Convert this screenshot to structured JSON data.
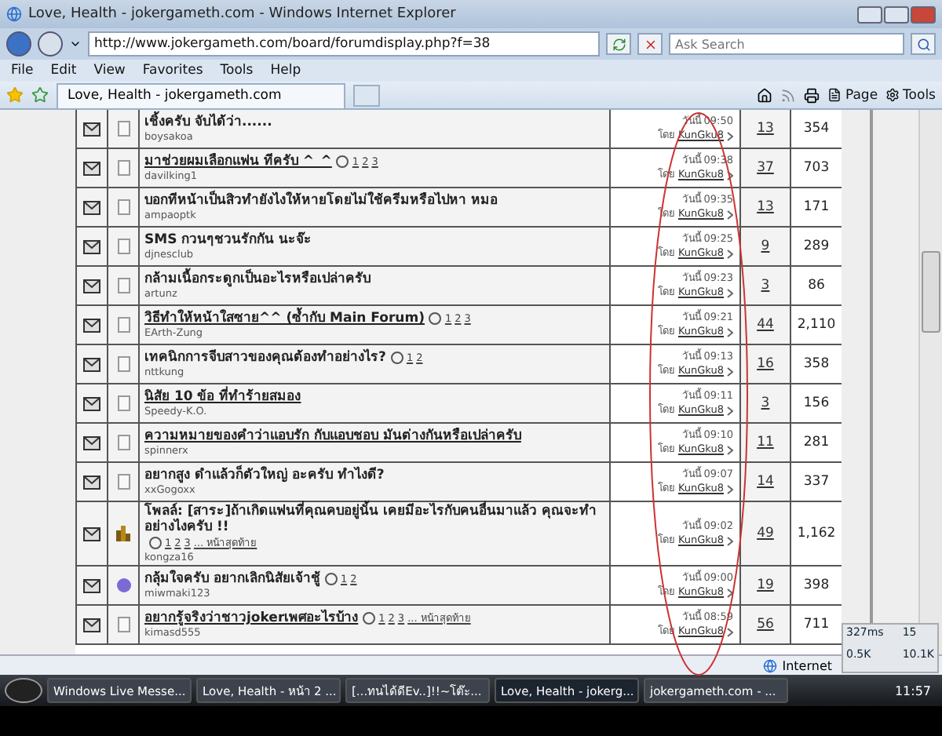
{
  "window": {
    "title": "Love, Health - jokergameth.com - Windows Internet Explorer"
  },
  "address_bar": {
    "url": "http://www.jokergameth.com/board/forumdisplay.php?f=38"
  },
  "search": {
    "placeholder": "Ask Search"
  },
  "menu": [
    "File",
    "Edit",
    "View",
    "Favorites",
    "Tools",
    "Help"
  ],
  "tabs": [
    {
      "label": "Love, Health - jokergameth.com",
      "selected": true
    }
  ],
  "command_bar": {
    "page": "Page",
    "tools": "Tools"
  },
  "threads": [
    {
      "kind": "doc",
      "title": "เชิ้งครับ จับได้ว่า......",
      "underlined": false,
      "author": "boysakoa",
      "day": "วันนี้",
      "time": "09:50",
      "by": "โดย",
      "last_poster": "KunGku8",
      "replies": "13",
      "views": "354"
    },
    {
      "kind": "doc",
      "title": "มาช่วยผมเลือกแฟน ทีครับ ^_^",
      "underlined": true,
      "pages": [
        "1",
        "2",
        "3"
      ],
      "author": "davilking1",
      "day": "วันนี้",
      "time": "09:38",
      "by": "โดย",
      "last_poster": "KunGku8",
      "replies": "37",
      "views": "703"
    },
    {
      "kind": "doc",
      "title": "บอกทีหน้าเป็นสิวทำยังไงให้หายโดยไม่ใช้ครีมหรือไปหา หมอ",
      "underlined": false,
      "author": "ampaoptk",
      "day": "วันนี้",
      "time": "09:35",
      "by": "โดย",
      "last_poster": "KunGku8",
      "replies": "13",
      "views": "171"
    },
    {
      "kind": "doc",
      "title": "SMS กวนๆชวนรักกัน นะจ๊ะ",
      "underlined": false,
      "author": "djnesclub",
      "day": "วันนี้",
      "time": "09:25",
      "by": "โดย",
      "last_poster": "KunGku8",
      "replies": "9",
      "views": "289"
    },
    {
      "kind": "doc",
      "title": "กล้ามเนื้อกระดูกเป็นอะไรหรือเปล่าครับ",
      "underlined": false,
      "author": "artunz",
      "day": "วันนี้",
      "time": "09:23",
      "by": "โดย",
      "last_poster": "KunGku8",
      "replies": "3",
      "views": "86"
    },
    {
      "kind": "doc",
      "title": "วิธีทำให้หน้าใสซาย^^ (ซ้ำกับ Main Forum)",
      "underlined": true,
      "pages": [
        "1",
        "2",
        "3"
      ],
      "author": "EArth-Zung",
      "day": "วันนี้",
      "time": "09:21",
      "by": "โดย",
      "last_poster": "KunGku8",
      "replies": "44",
      "views": "2,110"
    },
    {
      "kind": "doc",
      "title": "เทคนิกการจีบสาวของคุณต้องทำอย่างไร?",
      "underlined": false,
      "pages": [
        "1",
        "2"
      ],
      "author": "nttkung",
      "day": "วันนี้",
      "time": "09:13",
      "by": "โดย",
      "last_poster": "KunGku8",
      "replies": "16",
      "views": "358"
    },
    {
      "kind": "doc",
      "title": "นิสัย 10 ข้อ ที่ทำร้ายสมอง",
      "underlined": true,
      "author": "Speedy-K.O.",
      "day": "วันนี้",
      "time": "09:11",
      "by": "โดย",
      "last_poster": "KunGku8",
      "replies": "3",
      "views": "156"
    },
    {
      "kind": "doc",
      "title": "ความหมายของคำว่าแอบรัก กับแอบชอบ มันต่างกันหรือเปล่าครับ",
      "underlined": true,
      "author": "spinnerx",
      "day": "วันนี้",
      "time": "09:10",
      "by": "โดย",
      "last_poster": "KunGku8",
      "replies": "11",
      "views": "281"
    },
    {
      "kind": "doc",
      "title": "อยากสูง ดำแล้วก็ตัวใหญ่ อะครับ ทำไงดี?",
      "underlined": false,
      "author": "xxGogoxx",
      "day": "วันนี้",
      "time": "09:07",
      "by": "โดย",
      "last_poster": "KunGku8",
      "replies": "14",
      "views": "337"
    },
    {
      "kind": "poll",
      "title": "โพลล์: [สาระ]ถ้าเกิดแฟนที่คุณคบอยู่นั้น เคยมีอะไรกับคนอื่นมาแล้ว คุณจะทำอย่างไงครับ !!",
      "underlined": false,
      "pages": [
        "1",
        "2",
        "3"
      ],
      "last_page": "... หน้าสุดท้าย",
      "author": "kongza16",
      "day": "วันนี้",
      "time": "09:02",
      "by": "โดย",
      "last_poster": "KunGku8",
      "replies": "49",
      "views": "1,162"
    },
    {
      "kind": "smile",
      "title": "กลุ้มใจครับ อยากเลิกนิสัยเจ้าชู้",
      "underlined": false,
      "pages": [
        "1",
        "2"
      ],
      "author": "miwmaki123",
      "day": "วันนี้",
      "time": "09:00",
      "by": "โดย",
      "last_poster": "KunGku8",
      "replies": "19",
      "views": "398"
    },
    {
      "kind": "doc",
      "title": "อยากรู้จริงว่าชาวjokerเพศอะไรบ้าง",
      "underlined": true,
      "pages": [
        "1",
        "2",
        "3"
      ],
      "last_page": "... หน้าสุดท้าย",
      "author": "kimasd555",
      "day": "วันนี้",
      "time": "08:59",
      "by": "โดย",
      "last_poster": "KunGku8",
      "replies": "56",
      "views": "711"
    }
  ],
  "net_meter": {
    "ping": "327ms",
    "count": "15",
    "up": "0.5K",
    "down": "10.1K"
  },
  "status_bar": {
    "zone": "Internet"
  },
  "taskbar": {
    "items": [
      {
        "label": "Windows Live Messe...",
        "selected": false
      },
      {
        "label": "Love, Health - หน้า 2 ...",
        "selected": false
      },
      {
        "label": "[...ทนได้ดีEv..]!!~โต๊ะ...",
        "selected": false
      },
      {
        "label": "Love, Health - jokerg...",
        "selected": true
      },
      {
        "label": "jokergameth.com - ...",
        "selected": false
      }
    ],
    "clock": "11:57"
  }
}
